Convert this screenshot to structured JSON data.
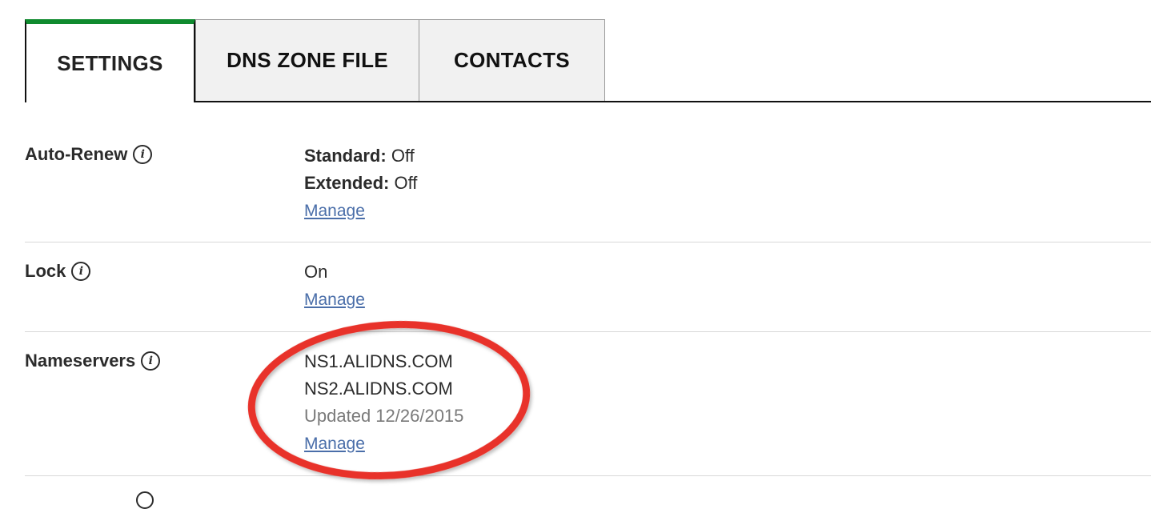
{
  "tabs": [
    {
      "label": "SETTINGS",
      "active": true
    },
    {
      "label": "DNS ZONE FILE",
      "active": false
    },
    {
      "label": "CONTACTS",
      "active": false
    }
  ],
  "accent_color": "#0f8a2e",
  "link_color": "#4a6ea9",
  "annotation_color": "#e8332a",
  "settings": {
    "auto_renew": {
      "label": "Auto-Renew",
      "info_icon": "info-icon",
      "standard_key": "Standard:",
      "standard_value": "Off",
      "extended_key": "Extended:",
      "extended_value": "Off",
      "manage": "Manage"
    },
    "lock": {
      "label": "Lock",
      "info_icon": "info-icon",
      "value": "On",
      "manage": "Manage"
    },
    "nameservers": {
      "label": "Nameservers",
      "info_icon": "info-icon",
      "servers": [
        "NS1.ALIDNS.COM",
        "NS2.ALIDNS.COM"
      ],
      "updated": "Updated 12/26/2015",
      "manage": "Manage"
    }
  },
  "info_glyph": "i"
}
